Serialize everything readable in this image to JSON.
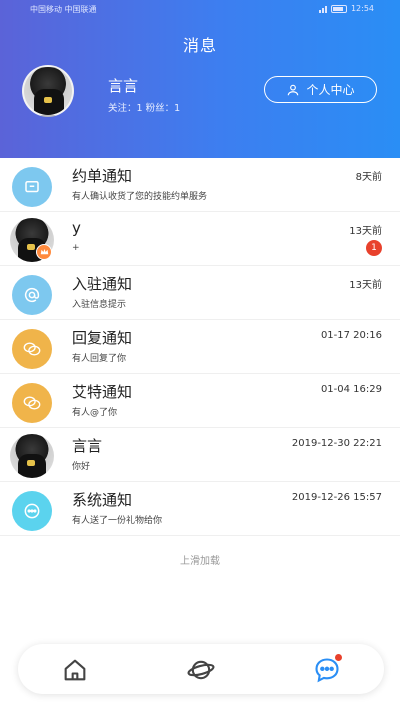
{
  "status_bar": {
    "carrier": "中国移动 中国联通",
    "time": "12:54"
  },
  "header": {
    "title": "消息",
    "profile": {
      "name": "言言",
      "stats": "关注：1 粉丝：1"
    },
    "center_button": "个人中心"
  },
  "messages": [
    {
      "title": "约单通知",
      "subtitle": "有人确认收货了您的技能约单服务",
      "time": "8天前",
      "icon": "chat-box-icon",
      "color": "#7dc8ef"
    },
    {
      "title": "y",
      "subtitle": "+",
      "time": "13天前",
      "badge": "1",
      "icon": "user-photo"
    },
    {
      "title": "入驻通知",
      "subtitle": "入驻信息提示",
      "time": "13天前",
      "icon": "at-icon",
      "color": "#7dc8ef"
    },
    {
      "title": "回复通知",
      "subtitle": "有人回复了你",
      "time": "01-17 20:16",
      "icon": "reply-bubbles-icon",
      "color": "#f0b44a"
    },
    {
      "title": "艾特通知",
      "subtitle": "有人@了你",
      "time": "01-04 16:29",
      "icon": "mention-bubbles-icon",
      "color": "#f0b44a"
    },
    {
      "title": "言言",
      "subtitle": "你好",
      "time": "2019-12-30 22:21",
      "icon": "user-photo"
    },
    {
      "title": "系统通知",
      "subtitle": "有人送了一份礼物给你",
      "time": "2019-12-26 15:57",
      "icon": "system-dots-icon",
      "color": "#5bd3ee"
    }
  ],
  "load_more": "上滑加载",
  "tabbar": {
    "items": [
      "home-icon",
      "planet-icon",
      "message-icon"
    ],
    "active": "message-icon",
    "active_color": "#2a8ef5"
  }
}
